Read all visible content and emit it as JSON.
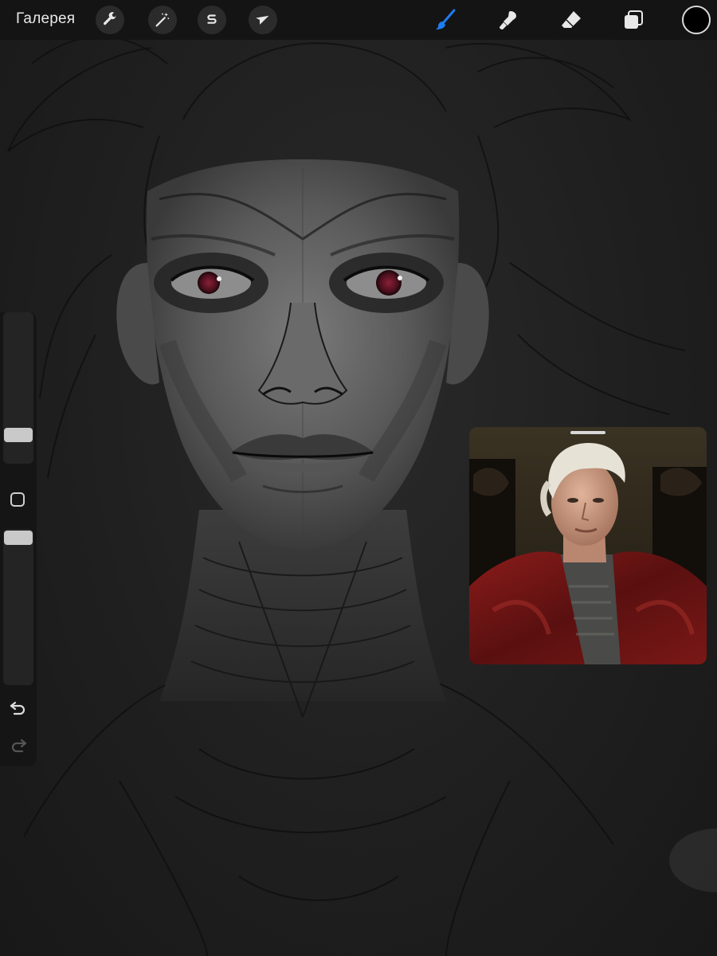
{
  "toolbar": {
    "gallery_label": "Галерея",
    "left_tools": [
      {
        "id": "actions",
        "icon": "wrench-icon"
      },
      {
        "id": "adjustments",
        "icon": "magic-wand-icon"
      },
      {
        "id": "selection",
        "icon": "selection-s-icon"
      },
      {
        "id": "transform",
        "icon": "arrow-cursor-icon"
      }
    ],
    "right_tools": [
      {
        "id": "brush",
        "icon": "brush-icon",
        "active": true
      },
      {
        "id": "smudge",
        "icon": "smudge-icon",
        "active": false
      },
      {
        "id": "eraser",
        "icon": "eraser-icon",
        "active": false
      },
      {
        "id": "layers",
        "icon": "layers-icon",
        "active": false
      }
    ],
    "active_color": "#000000",
    "accent_color": "#1e7cf0"
  },
  "sidebar": {
    "brush_size_level": 0.15,
    "opacity_level": 1.0,
    "icons": [
      "modify-square-icon",
      "undo-icon",
      "redo-icon"
    ]
  },
  "reference": {
    "title": "",
    "icon": "reference-photo-icon"
  }
}
